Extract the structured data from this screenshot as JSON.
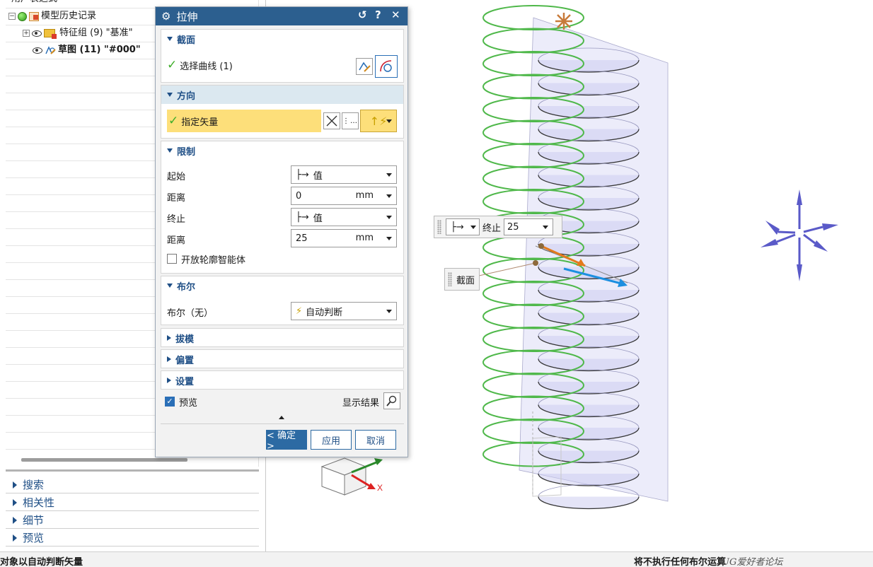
{
  "tree": {
    "row0_label": "用户表达式",
    "history": "模型历史记录",
    "feature_group": "特征组 (9) \"基准\"",
    "sketch": "草图 (11) \"#000\""
  },
  "nav_sections": [
    "搜索",
    "相关性",
    "细节",
    "预览"
  ],
  "dialog": {
    "title": "拉伸",
    "title_buttons": {
      "reset": "↺",
      "help": "?",
      "close": "✕"
    },
    "section_group": {
      "title": "截面",
      "select_curve": "选择曲线 (1)"
    },
    "direction_group": {
      "title": "方向",
      "specify_vector": "指定矢量"
    },
    "limits_group": {
      "title": "限制",
      "start_label": "起始",
      "start_value": "值",
      "start_distance_label": "距离",
      "start_distance": "0",
      "start_unit": "mm",
      "end_label": "终止",
      "end_value": "值",
      "end_distance_label": "距离",
      "end_distance": "25",
      "end_unit": "mm",
      "open_profile": "开放轮廓智能体"
    },
    "boolean_group": {
      "title": "布尔",
      "label": "布尔（无）",
      "value": "自动判断"
    },
    "draft": "拔模",
    "offset": "偏置",
    "settings": "设置",
    "preview": "预览",
    "show_result": "显示结果",
    "ok": "< 确定 >",
    "apply": "应用",
    "cancel": "取消"
  },
  "handles": {
    "end_label": "终止",
    "end_value": "25",
    "section_label": "截面"
  },
  "axis_x_label": "X",
  "status": {
    "left": "对象以自动判断矢量",
    "right": "将不执行任何布尔运算",
    "watermark": "UG爱好者论坛 WWW.UGSNX.COM"
  }
}
